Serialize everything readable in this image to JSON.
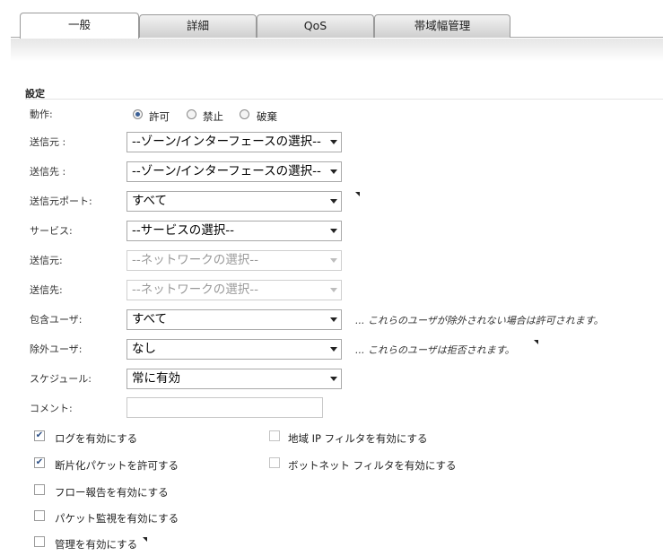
{
  "tabs": [
    {
      "label": "一般",
      "active": true
    },
    {
      "label": "詳細",
      "active": false
    },
    {
      "label": "QoS",
      "active": false
    },
    {
      "label": "帯域幅管理",
      "active": false
    }
  ],
  "section": {
    "title": "設定"
  },
  "action": {
    "label": "動作:",
    "options": [
      "許可",
      "禁止",
      "破棄"
    ],
    "selected": "許可"
  },
  "fields": {
    "source_zone": {
      "label": "送信元 :",
      "value": "--ゾーン/インターフェースの選択--"
    },
    "dest_zone": {
      "label": "送信先 :",
      "value": "--ゾーン/インターフェースの選択--"
    },
    "source_port": {
      "label": "送信元ポート:",
      "value": "すべて"
    },
    "service": {
      "label": "サービス:",
      "value": "--サービスの選択--"
    },
    "source_net": {
      "label": "送信元:",
      "value": "--ネットワークの選択--"
    },
    "dest_net": {
      "label": "送信先:",
      "value": "--ネットワークの選択--"
    },
    "include_users": {
      "label": "包含ユーザ:",
      "value": "すべて",
      "note": "... これらのユーザが除外されない場合は許可されます。"
    },
    "exclude_users": {
      "label": "除外ユーザ:",
      "value": "なし",
      "note": "... これらのユーザは拒否されます。"
    },
    "schedule": {
      "label": "スケジュール:",
      "value": "常に有効"
    },
    "comment": {
      "label": "コメント:",
      "value": ""
    }
  },
  "checkboxes": {
    "enable_logging": {
      "label": "ログを有効にする",
      "checked": true
    },
    "allow_fragments": {
      "label": "断片化パケットを許可する",
      "checked": true
    },
    "flow_reporting": {
      "label": "フロー報告を有効にする",
      "checked": false
    },
    "packet_monitor": {
      "label": "パケット監視を有効にする",
      "checked": false
    },
    "management": {
      "label": "管理を有効にする",
      "checked": false
    },
    "geo_ip": {
      "label": "地域 IP フィルタを有効にする",
      "checked": false
    },
    "botnet": {
      "label": "ボットネット フィルタを有効にする",
      "checked": false
    }
  },
  "icons": {
    "check": "✔"
  },
  "colors": {
    "accent": "#3a5f96",
    "border": "#a9a9a9",
    "disabled_text": "#9a9a9a"
  }
}
